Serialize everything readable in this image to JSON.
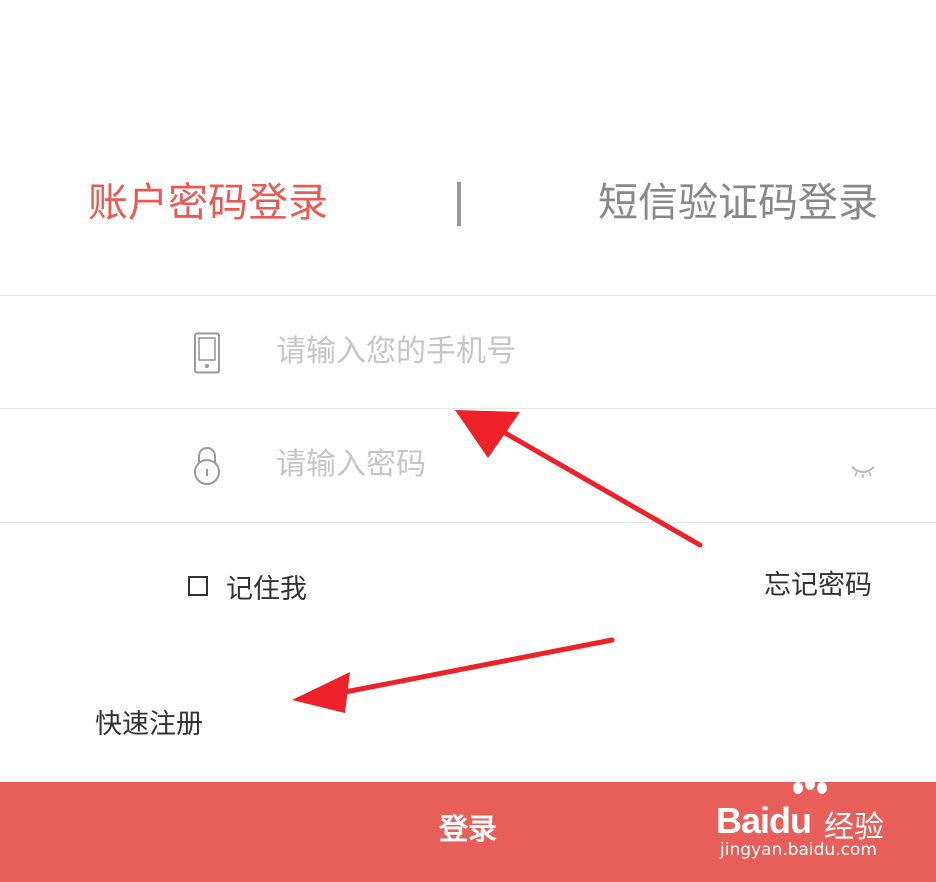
{
  "tabs": {
    "active_label": "账户密码登录",
    "inactive_label": "短信验证码登录",
    "separator": "|"
  },
  "form": {
    "phone_placeholder": "请输入您的手机号",
    "password_placeholder": "请输入密码",
    "phone_value": "",
    "password_value": ""
  },
  "options": {
    "remember_label": "记住我",
    "remember_checked": false,
    "forgot_label": "忘记密码",
    "register_label": "快速注册"
  },
  "login_button": {
    "label": "登录"
  },
  "watermark": {
    "logo_left": "Bai",
    "logo_right": "du",
    "brand": "经验",
    "url": "jingyan.baidu.com"
  },
  "colors": {
    "accent": "#e85b55",
    "button": "#e85f5a",
    "annotation_arrow": "#ee2128",
    "placeholder": "#c6c6c6",
    "inactive_tab": "#888888"
  },
  "icons": {
    "phone_field": "phone-icon",
    "password_field": "lock-icon",
    "password_toggle": "eye-closed-icon",
    "remember": "checkbox-icon"
  }
}
